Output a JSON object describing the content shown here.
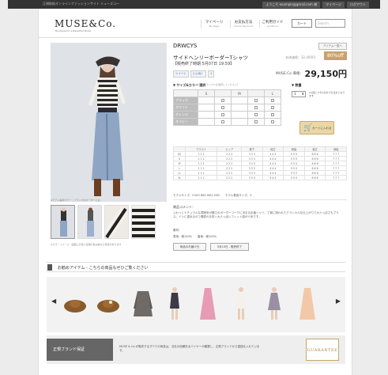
{
  "topbar": {
    "left_text": "正規取扱オンラインファッションサイト ミューズコー",
    "welcome": "ようこそ example@gmail.com 様",
    "btn_mypage": "マイページ",
    "btn_logout": "ログアウト"
  },
  "header": {
    "logo": "MUSE&Co.",
    "logo_sub": "Boutique for a Beautiful Mode",
    "nav": [
      {
        "main": "マイページ",
        "sub": "My Page"
      },
      {
        "main": "お支払方法",
        "sub": "Online Payment"
      },
      {
        "main": "ご利用ガイド",
        "sub": "guidance"
      }
    ],
    "cart": "カート",
    "search_placeholder": "Search"
  },
  "product": {
    "brand": "DRWCYS",
    "fav_btn": "アイテム一覧へ",
    "title": "サイドヘンリーボーダーTシャツ",
    "release": "【販売終了時期 5月07日 19:59】",
    "point_label": "本体価格：32,400円",
    "off": "80%off",
    "social": [
      "ツイート",
      "いいね！",
      "1"
    ],
    "price_label": "MUSE.Co 価格：",
    "price": "29,150円",
    "photo_caption": "※モデル着用カラー：ブラックのボーダーに白",
    "thumb_caption": "※カラーイメージ：画面上の色と実物の色は異なる場合があります"
  },
  "selection": {
    "heading": "▼ サイズ&カラー 選択",
    "note": "（チェックボックスを選択してください）",
    "sizes": [
      "S",
      "M",
      "L"
    ],
    "colors": [
      "ブラック",
      "ホワイト",
      "オレンジ",
      "ネイビー"
    ],
    "qty_heading": "▼ 数量",
    "qty_value": "1",
    "qty_note": "※1回につき2点までの注文となります",
    "cart_button": "カートに入れる"
  },
  "size_table": {
    "headers": [
      "",
      "ウエスト",
      "ヒップ",
      "股下",
      "総丈",
      "肩幅",
      "袖丈",
      "身幅"
    ],
    "rows": [
      [
        "XS",
        "1 1 1",
        "2 2 2",
        "3 3 3",
        "4 4 4",
        "5 5 5",
        "6 6 6",
        "7 7 7"
      ],
      [
        "S",
        "1 1 1",
        "2 2 2",
        "3 3 3",
        "4 4 4",
        "5 5 5",
        "6 6 6",
        "7 7 7"
      ],
      [
        "M",
        "1 1 1",
        "2 2 2",
        "3 3 3",
        "4 4 4",
        "5 5 5",
        "6 6 6",
        "7 7 7"
      ],
      [
        "L",
        "1 1 1",
        "2 2 2",
        "3 3 3",
        "4 4 4",
        "5 5 5",
        "6 6 6",
        "7 7 7"
      ],
      [
        "LL",
        "1 1 1",
        "2 2 2",
        "3 3 3",
        "4 4 4",
        "5 5 5",
        "6 6 6",
        "7 7 7"
      ],
      [
        "3L",
        "1 1 1",
        "2 2 2",
        "3 3 3",
        "4 4 4",
        "5 5 5",
        "6 6 6",
        "7 7 7"
      ]
    ],
    "model_note": "モデルサイズ：H163 B80 W62 H85　　モデル着用サイズ：S"
  },
  "description": {
    "heading": "商品コメント：",
    "body": "ふわっとナチュラルな雰囲気が魅力のボーダーコーデに決まる定番シャツ。丁寧に縫われたクラシカルな仕上がりで大人っぽさもプラス。インに重ねるので着膨れを防ぐ大人っぽいフィット感が人気です。",
    "material_heading": "素材：",
    "material": "表地：綿100%　　裏地：綿100%",
    "btn_delivery": "商品のお届け日",
    "btn_sale_end": "5月10日 - 販売終了"
  },
  "recommend": {
    "heading": "お勧めアイテム - こちらの商品もぜひご覧ください",
    "prev_arrow": "◀",
    "next_arrow": "▶",
    "items": [
      "hat-icon",
      "hat-icon",
      "cardigan-icon",
      "dress-icon",
      "dress-icon",
      "dress-icon",
      "dress-icon",
      "dress-icon"
    ]
  },
  "footer": {
    "label": "正規ブランド保証",
    "text": "MUSE & Co.が販売するすべての商品は、当社の信頼あるバイヤーが厳選し、正規ブランドから直接仕入れています。",
    "badge": "GUARANTEE"
  }
}
